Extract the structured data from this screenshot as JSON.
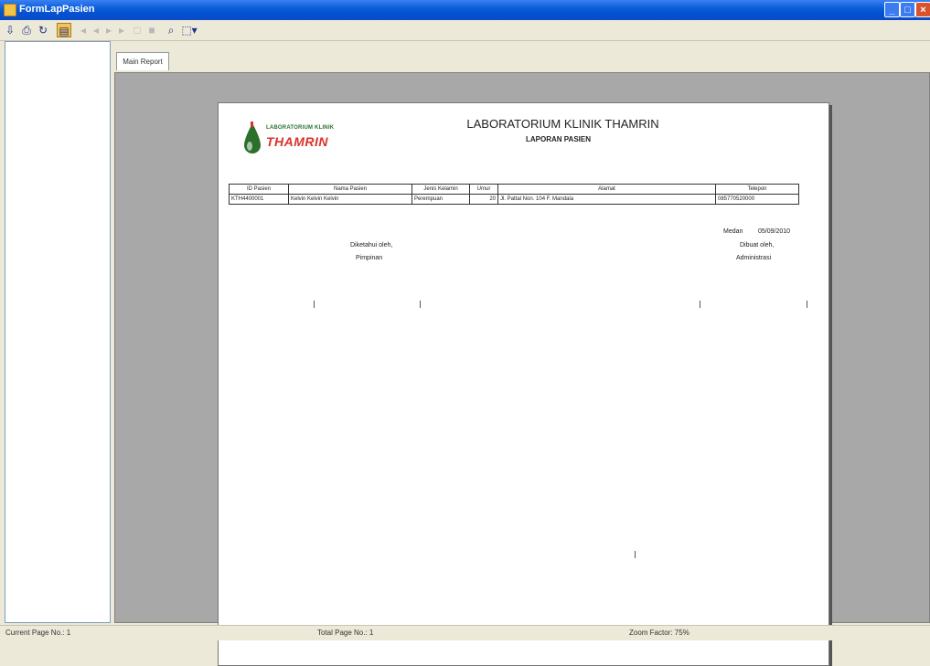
{
  "window": {
    "title": "FormLapPasien"
  },
  "toolbar": {
    "items": [
      "export-icon",
      "print-icon",
      "refresh-icon",
      "toggle-tree-icon",
      "first-page-icon",
      "prev-page-icon",
      "next-page-icon",
      "last-page-icon",
      "goto-page-icon",
      "stop-icon",
      "search-icon",
      "zoom-icon"
    ]
  },
  "tabs": [
    {
      "label": "Main Report"
    }
  ],
  "report": {
    "logo_top": "LABORATORIUM KLINIK",
    "logo_name": "THAMRIN",
    "title": "LABORATORIUM KLINIK THAMRIN",
    "subtitle": "LAPORAN PASIEN",
    "columns": [
      "ID Pasien",
      "Nama Pasien",
      "Jenis Kelamin",
      "Umur",
      "Alamat",
      "Telepon"
    ],
    "rows": [
      {
        "id": "KTH4400001",
        "nama": "Kelvin Kelvin Kelvin",
        "jk": "Perempuan",
        "umur": "20",
        "alamat": "Jl. Pattal Non. 104 F. Mandala",
        "telepon": "085770520000"
      }
    ],
    "place_date_label": "Medan",
    "date": "05/09/2010",
    "left_signature": {
      "line1": "Diketahui oleh,",
      "line2": "Pimpinan"
    },
    "right_signature": {
      "line1": "Dibuat oleh,",
      "line2": "Administrasi"
    }
  },
  "status": {
    "current_page": "Current Page No.: 1",
    "total_page": "Total Page No.: 1",
    "zoom": "Zoom Factor: 75%"
  },
  "colors": {
    "titlebar": "#0550d2",
    "viewer_bg": "#a8a8a8",
    "logo_red": "#d9332a",
    "logo_green": "#2b6f2b"
  }
}
